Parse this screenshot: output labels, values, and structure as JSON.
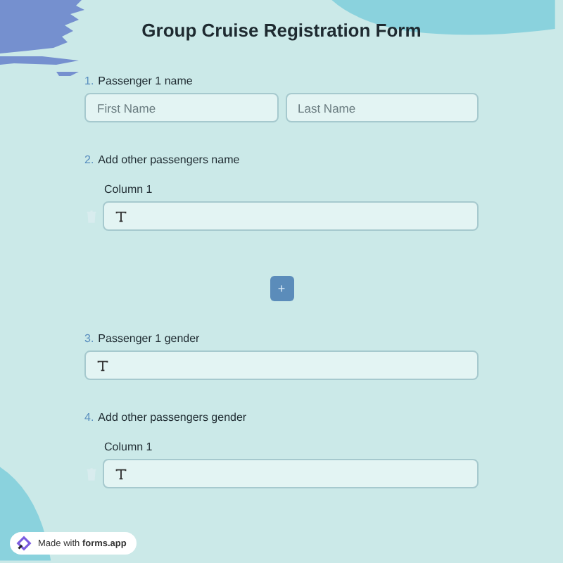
{
  "title": "Group Cruise Registration Form",
  "questions": [
    {
      "kind": "name",
      "number": "1.",
      "label": "Passenger 1 name",
      "first_placeholder": "First Name",
      "last_placeholder": "Last Name"
    },
    {
      "kind": "repeat",
      "number": "2.",
      "label": "Add other passengers name",
      "column": "Column 1",
      "add_label": "+"
    },
    {
      "kind": "text",
      "number": "3.",
      "label": "Passenger 1 gender"
    },
    {
      "kind": "repeat",
      "number": "4.",
      "label": "Add other passengers gender",
      "column": "Column 1"
    }
  ],
  "badge": "Made with **forms.app**"
}
